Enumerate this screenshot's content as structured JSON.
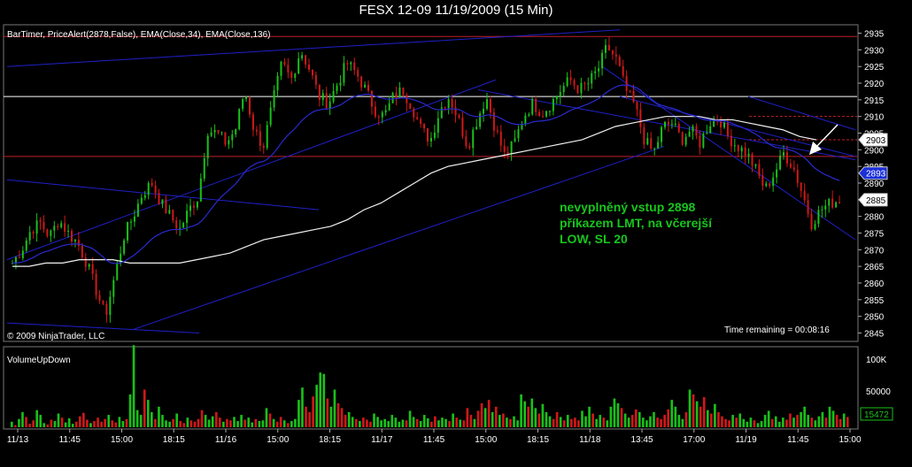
{
  "window": {
    "title": "FESX 12-09  11/19/2009 (15 Min)"
  },
  "price_panel": {
    "indicator_label": "BarTimer, PriceAlert(2878,False), EMA(Close,34), EMA(Close,136)",
    "copyright": "© 2009 NinjaTrader, LLC",
    "time_remaining": "Time remaining = 00:08:16",
    "annotation_lines": [
      "nevyplněný vstup 2898",
      "příkazem LMT, na včerejší",
      "LOW, SL 20"
    ],
    "price_tags": [
      {
        "label": "2903",
        "value": 2903,
        "color": "#ffffff"
      },
      {
        "label": "2893",
        "value": 2893,
        "color": "#1a2fd8"
      },
      {
        "label": "2885",
        "value": 2885,
        "color": "#ffffff"
      }
    ],
    "horizontal_levels": [
      {
        "value": 2934,
        "color": "#c0202a"
      },
      {
        "value": 2916,
        "color": "#ffffff"
      },
      {
        "value": 2898,
        "color": "#c0202a"
      }
    ]
  },
  "volume_panel": {
    "indicator_label": "VolumeUpDown",
    "y_ticks": [
      "100K",
      "50000"
    ],
    "last_volume_tag": "15472",
    "last_volume": 15472
  },
  "chart_data": [
    {
      "type": "candlestick",
      "title": "FESX 12-09  11/19/2009 (15 Min)",
      "ylim": [
        2843,
        2937
      ],
      "y_ticks": [
        2845,
        2850,
        2855,
        2860,
        2865,
        2870,
        2875,
        2880,
        2885,
        2890,
        2895,
        2900,
        2905,
        2910,
        2915,
        2920,
        2925,
        2930,
        2935
      ],
      "x_ticks": [
        "11/13",
        "11:45",
        "15:00",
        "18:15",
        "11/16",
        "15:00",
        "18:15",
        "11/17",
        "11:45",
        "15:00",
        "18:15",
        "11/18",
        "13:45",
        "17:00",
        "11/19",
        "11:45",
        "15:00"
      ],
      "close_path": [
        2866,
        2870,
        2876,
        2878,
        2874,
        2879,
        2875,
        2872,
        2866,
        2858,
        2850,
        2862,
        2874,
        2880,
        2887,
        2890,
        2884,
        2880,
        2876,
        2882,
        2886,
        2906,
        2905,
        2902,
        2906,
        2918,
        2906,
        2901,
        2914,
        2926,
        2921,
        2930,
        2924,
        2916,
        2914,
        2920,
        2926,
        2923,
        2918,
        2912,
        2910,
        2916,
        2918,
        2913,
        2906,
        2903,
        2912,
        2916,
        2909,
        2901,
        2909,
        2916,
        2906,
        2898,
        2902,
        2910,
        2914,
        2911,
        2914,
        2918,
        2921,
        2918,
        2920,
        2924,
        2931,
        2927,
        2918,
        2913,
        2903,
        2899,
        2907,
        2908,
        2903,
        2906,
        2902,
        2908,
        2910,
        2904,
        2901,
        2899,
        2894,
        2888,
        2893,
        2899,
        2895,
        2887,
        2878,
        2882,
        2884,
        2885
      ],
      "trendlines": "blue channel lines",
      "series": [
        {
          "name": "EMA(Close,34)",
          "color": "#2a2ad0"
        },
        {
          "name": "EMA(Close,136)",
          "color": "#f0f0f0",
          "values": [
            2865,
            2865,
            2866,
            2866,
            2867,
            2867,
            2867,
            2866,
            2866,
            2866,
            2866,
            2867,
            2868,
            2869,
            2871,
            2873,
            2874,
            2875,
            2876,
            2877,
            2879,
            2882,
            2884,
            2887,
            2890,
            2893,
            2895,
            2896,
            2897,
            2898,
            2899,
            2900,
            2901,
            2902,
            2903,
            2905,
            2907,
            2908,
            2909,
            2910,
            2910,
            2910,
            2909,
            2909,
            2908,
            2907,
            2906,
            2904,
            2903
          ]
        }
      ]
    },
    {
      "type": "bar",
      "title": "VolumeUpDown",
      "ylim": [
        0,
        110000
      ],
      "y_ticks": [
        "100K",
        "50000"
      ],
      "values": [
        8,
        3,
        12,
        22,
        15,
        5,
        10,
        25,
        18,
        6,
        4,
        11,
        9,
        20,
        14,
        7,
        13,
        5,
        8,
        16,
        21,
        11,
        6,
        9,
        14,
        8,
        12,
        18,
        10,
        7,
        15,
        9,
        12,
        48,
        120,
        25,
        18,
        55,
        40,
        22,
        12,
        30,
        18,
        10,
        8,
        12,
        20,
        9,
        6,
        14,
        10,
        8,
        12,
        25,
        18,
        11,
        16,
        22,
        14,
        8,
        12,
        10,
        15,
        9,
        18,
        11,
        14,
        7,
        12,
        9,
        10,
        28,
        20,
        12,
        8,
        15,
        10,
        6,
        9,
        12,
        40,
        58,
        30,
        22,
        45,
        62,
        80,
        78,
        42,
        30,
        55,
        35,
        28,
        18,
        22,
        15,
        12,
        9,
        14,
        11,
        8,
        20,
        15,
        10,
        12,
        9,
        18,
        14,
        8,
        11,
        10,
        24,
        15,
        12,
        9,
        18,
        13,
        8,
        16,
        10,
        14,
        12,
        9,
        20,
        14,
        11,
        10,
        28,
        18,
        12,
        24,
        35,
        28,
        40,
        22,
        30,
        18,
        20,
        14,
        12,
        16,
        10,
        48,
        38,
        30,
        42,
        28,
        20,
        34,
        22,
        16,
        12,
        22,
        15,
        10,
        18,
        12,
        14,
        10,
        24,
        16,
        30,
        20,
        12,
        18,
        14,
        10,
        30,
        42,
        35,
        28,
        20,
        14,
        18,
        26,
        22,
        14,
        10,
        16,
        22,
        14,
        12,
        18,
        26,
        40,
        30,
        18,
        12,
        22,
        55,
        48,
        38,
        30,
        44,
        25,
        20,
        34,
        22,
        16,
        12,
        10,
        18,
        14,
        20,
        12,
        8,
        14,
        10,
        6,
        9,
        18,
        24,
        12,
        16,
        8,
        14,
        11,
        20,
        14,
        18,
        22,
        30,
        18,
        14,
        10,
        16,
        22,
        14,
        30,
        24,
        18,
        12,
        20,
        15
      ],
      "up_colors": [
        "#19c019",
        "#d01818"
      ]
    }
  ]
}
